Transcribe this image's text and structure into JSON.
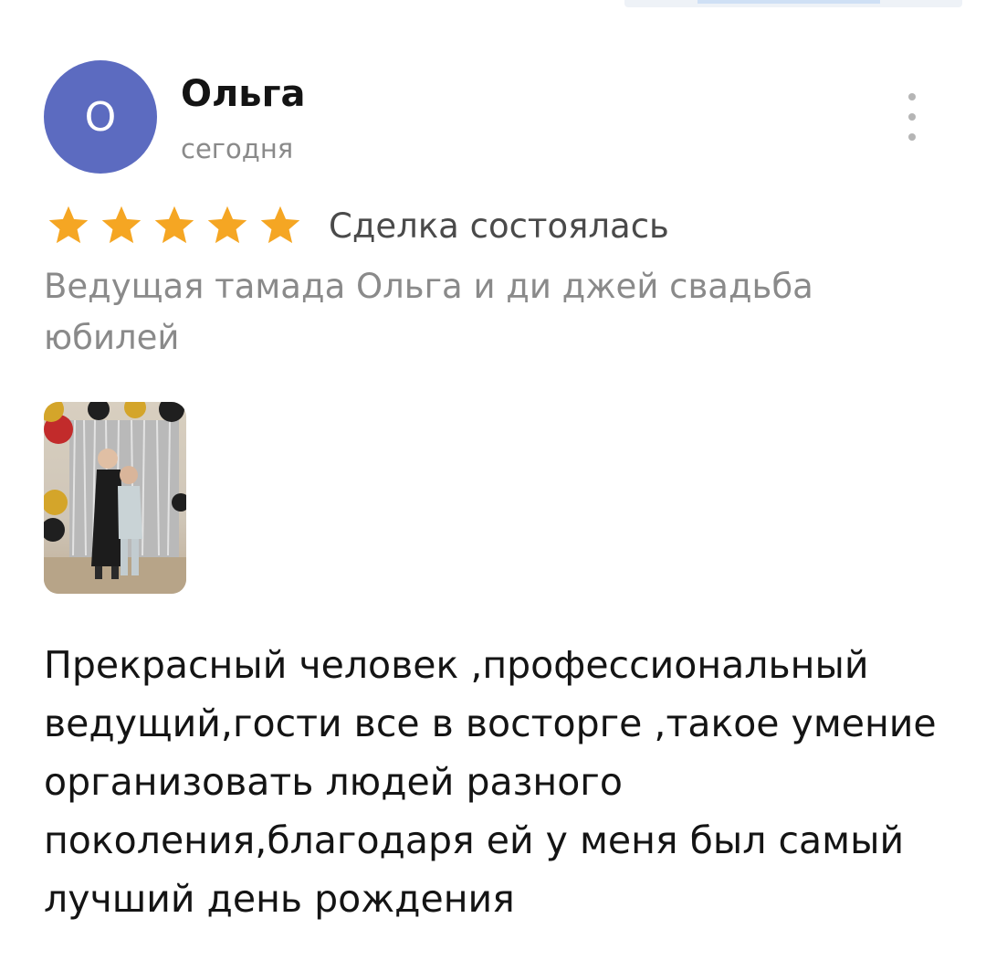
{
  "review": {
    "author_initial": "О",
    "author_name": "Ольга",
    "date": "сегодня",
    "avatar_color": "#5c6bc0",
    "rating": 5,
    "rating_max": 5,
    "star_color": "#f5a623",
    "deal_status": "Сделка состоялась",
    "listing_title": "Ведущая тамада Ольга и ди джей свадьба юбилей",
    "text": "Прекрасный человек ,профессиональный\nведущий,гости все в восторге ,такое умение\nорганизовать людей разного\nпоколения,благодаря ей у меня  был самый\nлучший день рождения",
    "more_icon": "more-vertical-icon",
    "photo_icon": "review-photo-thumbnail"
  }
}
